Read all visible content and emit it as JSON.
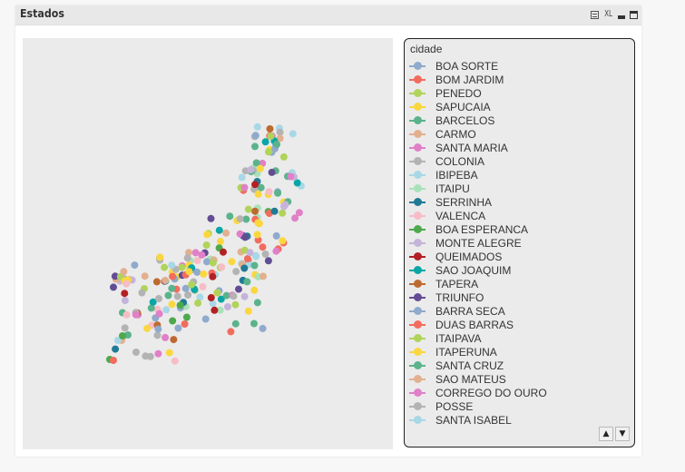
{
  "window": {
    "title": "Estados",
    "caption_icons": [
      {
        "name": "print-icon"
      },
      {
        "name": "excel-export-icon",
        "label": "XL"
      },
      {
        "name": "minimize-icon"
      },
      {
        "name": "maximize-icon"
      }
    ]
  },
  "legend": {
    "title": "cidade",
    "items": [
      {
        "label": "BOA SORTE",
        "color": "#8faacc"
      },
      {
        "label": "BOM JARDIM",
        "color": "#f26c5e"
      },
      {
        "label": "PENEDO",
        "color": "#b0d35a"
      },
      {
        "label": "SAPUCAIA",
        "color": "#fad73f"
      },
      {
        "label": "BARCELOS",
        "color": "#5bb38b"
      },
      {
        "label": "CARMO",
        "color": "#e2b08f"
      },
      {
        "label": "SANTA MARIA",
        "color": "#e080c8"
      },
      {
        "label": "COLONIA",
        "color": "#b3b3b3"
      },
      {
        "label": "IBIPEBA",
        "color": "#a8d8e6"
      },
      {
        "label": "ITAIPU",
        "color": "#a9e2ba"
      },
      {
        "label": "SERRINHA",
        "color": "#1f7a95"
      },
      {
        "label": "VALENCA",
        "color": "#f7bcc6"
      },
      {
        "label": "BOA ESPERANCA",
        "color": "#4ea94c"
      },
      {
        "label": "MONTE ALEGRE",
        "color": "#c5b4da"
      },
      {
        "label": "QUEIMADOS",
        "color": "#b32024"
      },
      {
        "label": "SAO JOAQUIM",
        "color": "#0aa6a6"
      },
      {
        "label": "TAPERA",
        "color": "#bd6a30"
      },
      {
        "label": "TRIUNFO",
        "color": "#624d94"
      },
      {
        "label": "BARRA SECA",
        "color": "#8faacc"
      },
      {
        "label": "DUAS BARRAS",
        "color": "#f26c5e"
      },
      {
        "label": "ITAIPAVA",
        "color": "#b0d35a"
      },
      {
        "label": "ITAPERUNA",
        "color": "#fad73f"
      },
      {
        "label": "SANTA CRUZ",
        "color": "#5bb38b"
      },
      {
        "label": "SAO MATEUS",
        "color": "#e2b08f"
      },
      {
        "label": "CORREGO DO OURO",
        "color": "#e080c8"
      },
      {
        "label": "POSSE",
        "color": "#b3b3b3"
      },
      {
        "label": "SANTA ISABEL",
        "color": "#a8d8e6"
      }
    ],
    "scroll_up_label": "^",
    "scroll_down_label": "v"
  },
  "map": {
    "type": "scatter",
    "background": "#ebebeb"
  }
}
